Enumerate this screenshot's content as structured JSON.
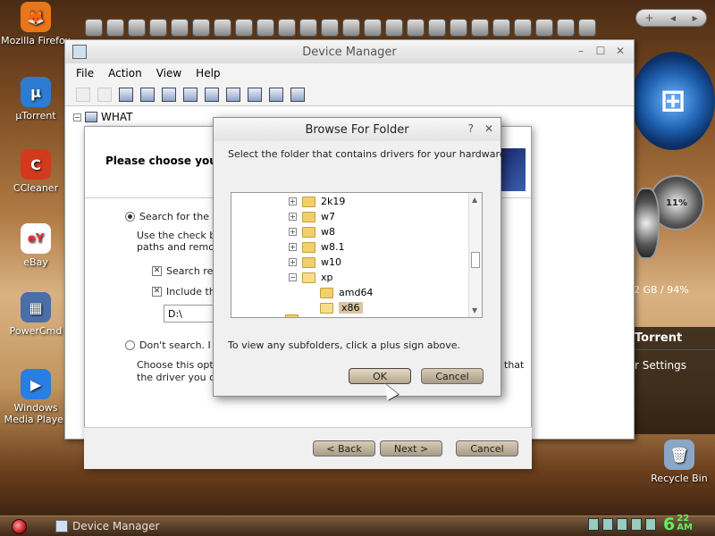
{
  "desktop": {
    "icons": [
      {
        "label": "Mozilla Firefox",
        "icon": "firefox-icon",
        "color": "#e8761a",
        "glyph": "🦊"
      },
      {
        "label": "µTorrent",
        "icon": "utorrent-icon",
        "color": "#2c7cd1",
        "glyph": "µ"
      },
      {
        "label": "CCleaner",
        "icon": "ccleaner-icon",
        "color": "#d23a1e",
        "glyph": "C"
      },
      {
        "label": "eBay",
        "icon": "ebay-icon",
        "color": "#ffffff",
        "glyph": "eY"
      },
      {
        "label": "PowerCmd",
        "icon": "powercmd-icon",
        "color": "#4a6ea8",
        "glyph": "▦"
      },
      {
        "label": "Windows Media Player",
        "icon": "media-player-icon",
        "color": "#2a7de1",
        "glyph": "▶"
      },
      {
        "label": "Recycle Bin",
        "icon": "recycle-bin-icon",
        "color": "#8aa7c6",
        "glyph": "🗑"
      }
    ],
    "gadgets": {
      "cpu_percent": "11%",
      "memory_text": "2 GB / 94%",
      "utorrent_title": "Torrent",
      "utorrent_settings": "r Settings"
    }
  },
  "device_manager": {
    "title": "Device Manager",
    "menu": [
      "File",
      "Action",
      "View",
      "Help"
    ],
    "tree_root": "WHAT"
  },
  "wizard": {
    "heading": "Please choose your s",
    "option_search": "Search for the be",
    "search_desc_1": "Use the check bo",
    "search_desc_2": "paths and remova",
    "chk_search_removable": "Search rem",
    "chk_include": "Include this",
    "path_value": "D:\\",
    "option_dont_search": "Don't search. I wi",
    "dont_desc_1": "Choose this optio",
    "dont_desc_2": "the driver you cho",
    "dont_desc_right": "that",
    "back_label": "< Back",
    "next_label": "Next >",
    "cancel_label": "Cancel"
  },
  "browse_folder": {
    "title": "Browse For Folder",
    "help_label": "?",
    "close_label": "✕",
    "instruction": "Select the folder that contains drivers for your hardware.",
    "tree_items": [
      {
        "label": "2k19",
        "expander": "+",
        "selected": false
      },
      {
        "label": "w7",
        "expander": "+",
        "selected": false
      },
      {
        "label": "w8",
        "expander": "+",
        "selected": false
      },
      {
        "label": "w8.1",
        "expander": "+",
        "selected": false
      },
      {
        "label": "w10",
        "expander": "+",
        "selected": false
      },
      {
        "label": "xp",
        "expander": "−",
        "selected": false
      },
      {
        "label": "amd64",
        "expander": "",
        "selected": false
      },
      {
        "label": "x86",
        "expander": "",
        "selected": true
      }
    ],
    "hint": "To view any subfolders, click a plus sign above.",
    "ok_label": "OK",
    "cancel_label": "Cancel"
  },
  "taskbar": {
    "task_label": "Device Manager",
    "clock_hour": "6",
    "clock_minutes": "22",
    "clock_ampm": "AM"
  }
}
